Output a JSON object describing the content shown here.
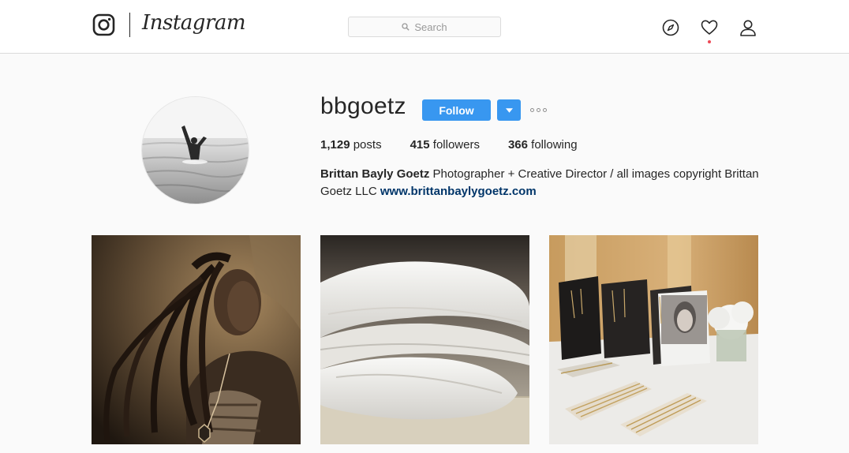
{
  "header": {
    "wordmark": "Instagram",
    "search_placeholder": "Search",
    "icons": [
      "instagram-camera-icon",
      "explore-compass-icon",
      "activity-heart-icon",
      "profile-person-icon"
    ],
    "notification_dot_color": "#ed4956"
  },
  "profile": {
    "username": "bbgoetz",
    "follow_label": "Follow",
    "stats": {
      "posts_count": "1,129",
      "posts_label": "posts",
      "followers_count": "415",
      "followers_label": "followers",
      "following_count": "366",
      "following_label": "following"
    },
    "bio": {
      "full_name": "Brittan Bayly Goetz",
      "text": " Photographer + Creative Director / all images copyright Brittan Goetz LLC ",
      "link": "www.brittanbaylygoetz.com"
    }
  },
  "posts": [
    {
      "description": "sepia portrait of a woman with long locs and a pendant necklace"
    },
    {
      "description": "folded white linens stacked on a table"
    },
    {
      "description": "jewelry display with portrait card and gold necklaces"
    }
  ],
  "colors": {
    "accent": "#3897f0",
    "link": "#003569",
    "border": "#dbdbdb",
    "background": "#fafafa"
  }
}
